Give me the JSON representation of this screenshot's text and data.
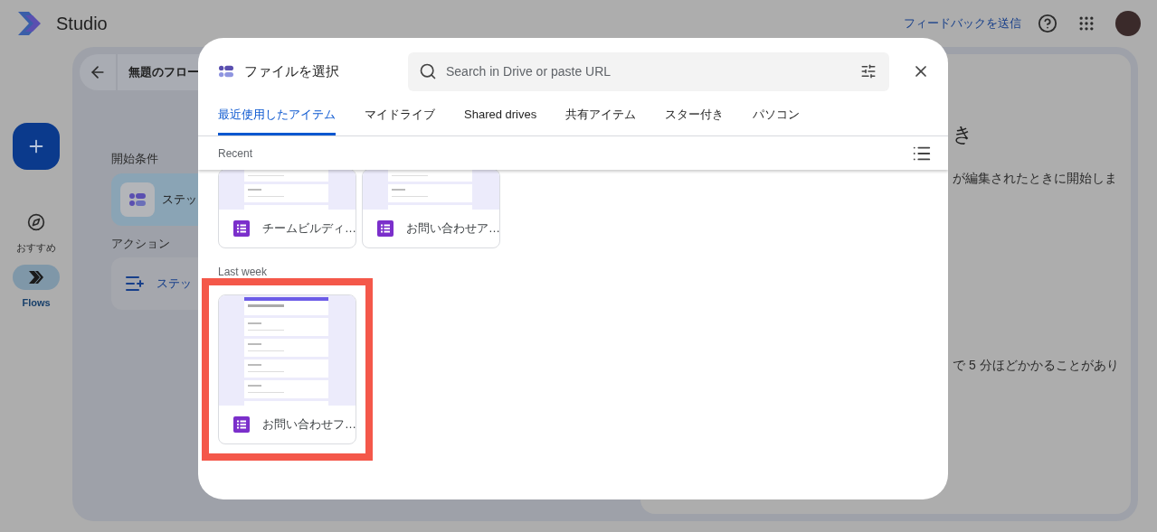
{
  "app": {
    "name": "Studio",
    "feedback_link": "フィードバックを送信"
  },
  "nav": [
    {
      "label": "おすすめ",
      "selected": false
    },
    {
      "label": "Flows",
      "selected": true
    }
  ],
  "flow": {
    "title": "無題のフロー",
    "sections": [
      {
        "heading": "開始条件",
        "step": "ステッ",
        "kind": "trigger"
      },
      {
        "heading": "アクション",
        "step": "ステッ",
        "kind": "action"
      }
    ]
  },
  "side_panel": {
    "heading": "き",
    "lines": [
      "が編集されたときに開始しま",
      "で 5 分ほどかかることがあり"
    ]
  },
  "picker": {
    "title": "ファイルを選択",
    "search": {
      "placeholder": "Search in Drive or paste URL"
    },
    "tabs": [
      {
        "label": "最近使用したアイテム",
        "selected": true
      },
      {
        "label": "マイドライブ",
        "selected": false
      },
      {
        "label": "Shared drives",
        "selected": false
      },
      {
        "label": "共有アイテム",
        "selected": false
      },
      {
        "label": "スター付き",
        "selected": false
      },
      {
        "label": "パソコン",
        "selected": false
      }
    ],
    "groups": [
      {
        "label": "Recent",
        "scrolled": true,
        "files": [
          {
            "name": "チームビルディ…",
            "highlighted": false
          },
          {
            "name": "お問い合わせア…",
            "highlighted": false
          }
        ]
      },
      {
        "label": "Last week",
        "scrolled": false,
        "files": [
          {
            "name": "お問い合わせフ…",
            "highlighted": true
          }
        ]
      }
    ]
  }
}
